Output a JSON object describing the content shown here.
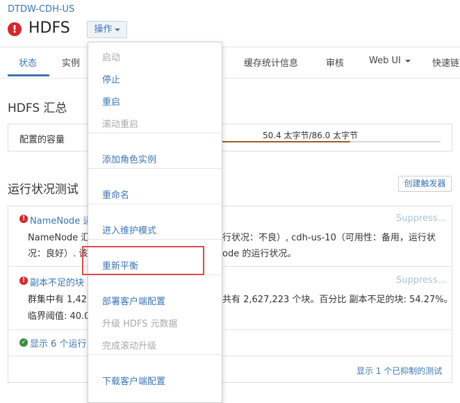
{
  "header": {
    "cluster": "DTDW-CDH-US",
    "service": "HDFS",
    "actions_label": "操作"
  },
  "tabs": [
    "状态",
    "实例",
    "缓存统计信息",
    "审核",
    "Web UI",
    "快速链"
  ],
  "summary": {
    "title": "HDFS 汇总",
    "capacity_label": "配置的容量",
    "capacity_value": "50.4 太字节/86.0 太字节",
    "capacity_fraction": 0.586
  },
  "health": {
    "title": "运行状况测试",
    "create_trigger": "创建触发器",
    "tests": [
      {
        "title": "NameNode 运",
        "line1": "NameNode 汇",
        "line1_tail": "行状况：不良）, cdh-us-10（可用性：备用，运行状",
        "line2": "况：良好）. 该",
        "line2_tail": "ode 的运行状况。",
        "suppress": "Suppress..."
      },
      {
        "title": "副本不足的块",
        "line1": "群集中有 1,425",
        "line1_tail": "共有 2,627,223 个块。百分比 副本不足的块: 54.27%。",
        "line2": "临界阈值: 40.0",
        "suppress": "Suppress..."
      }
    ],
    "show_ok": "显示 6 个运行良",
    "suppressed_link": "显示 1 个已抑制的测试"
  },
  "menu": {
    "groups": [
      [
        {
          "label": "启动",
          "enabled": false
        },
        {
          "label": "停止",
          "enabled": true
        },
        {
          "label": "重启",
          "enabled": true
        },
        {
          "label": "滚动重启",
          "enabled": false
        }
      ],
      [
        {
          "label": "添加角色实例",
          "enabled": true
        }
      ],
      [
        {
          "label": "重命名",
          "enabled": true
        }
      ],
      [
        {
          "label": "进入维护模式",
          "enabled": true
        }
      ],
      [
        {
          "label": "重新平衡",
          "enabled": true
        }
      ],
      [
        {
          "label": "部署客户端配置",
          "enabled": true
        },
        {
          "label": "升级 HDFS 元数据",
          "enabled": false
        },
        {
          "label": "完成滚动升级",
          "enabled": false
        }
      ],
      [
        {
          "label": "下载客户端配置",
          "enabled": true
        }
      ]
    ]
  },
  "colors": {
    "accent": "#3a76b4",
    "error": "#d9262c",
    "ok": "#3c8d3f",
    "highlight": "#e0474c"
  }
}
